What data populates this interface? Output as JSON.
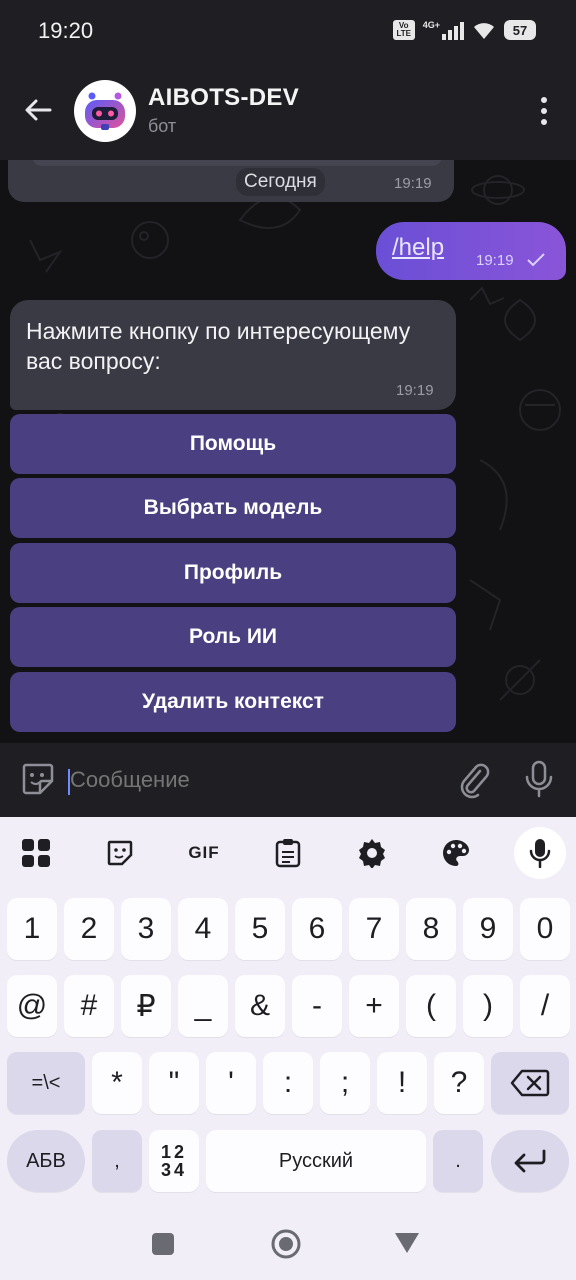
{
  "status_bar": {
    "time": "19:20",
    "volte_label": "Vo LTE",
    "network_label": "4G+",
    "battery": "57"
  },
  "header": {
    "title": "AIBOTS-DEV",
    "subtitle": "бот"
  },
  "chat": {
    "date_label": "Сегодня",
    "prev_time": "19:19",
    "outgoing": {
      "text": "/help",
      "time": "19:19"
    },
    "incoming": {
      "text": "Нажмите кнопку по интересующему вас вопросу:",
      "time": "19:19"
    },
    "inline_buttons": [
      "Помощь",
      "Выбрать модель",
      "Профиль",
      "Роль ИИ",
      "Удалить контекст"
    ]
  },
  "input": {
    "placeholder": "Сообщение"
  },
  "keyboard": {
    "toolbar": {
      "gif_label": "GIF"
    },
    "row1": [
      "1",
      "2",
      "3",
      "4",
      "5",
      "6",
      "7",
      "8",
      "9",
      "0"
    ],
    "row2": [
      "@",
      "#",
      "₽",
      "_",
      "&",
      "-",
      "+",
      "(",
      ")",
      "/"
    ],
    "row3": {
      "mode_label": "=\\<",
      "keys": [
        "*",
        "\"",
        "'",
        ":",
        ";",
        "!",
        "?"
      ]
    },
    "row4": {
      "abc_label": "АБВ",
      "comma": ",",
      "num_top": "12",
      "num_bottom": "34",
      "space_label": "Русский",
      "period": "."
    }
  },
  "colors": {
    "accent": "#7b55d8",
    "inline_button": "#4a3f80",
    "bubble_incoming": "#3a3a45"
  }
}
